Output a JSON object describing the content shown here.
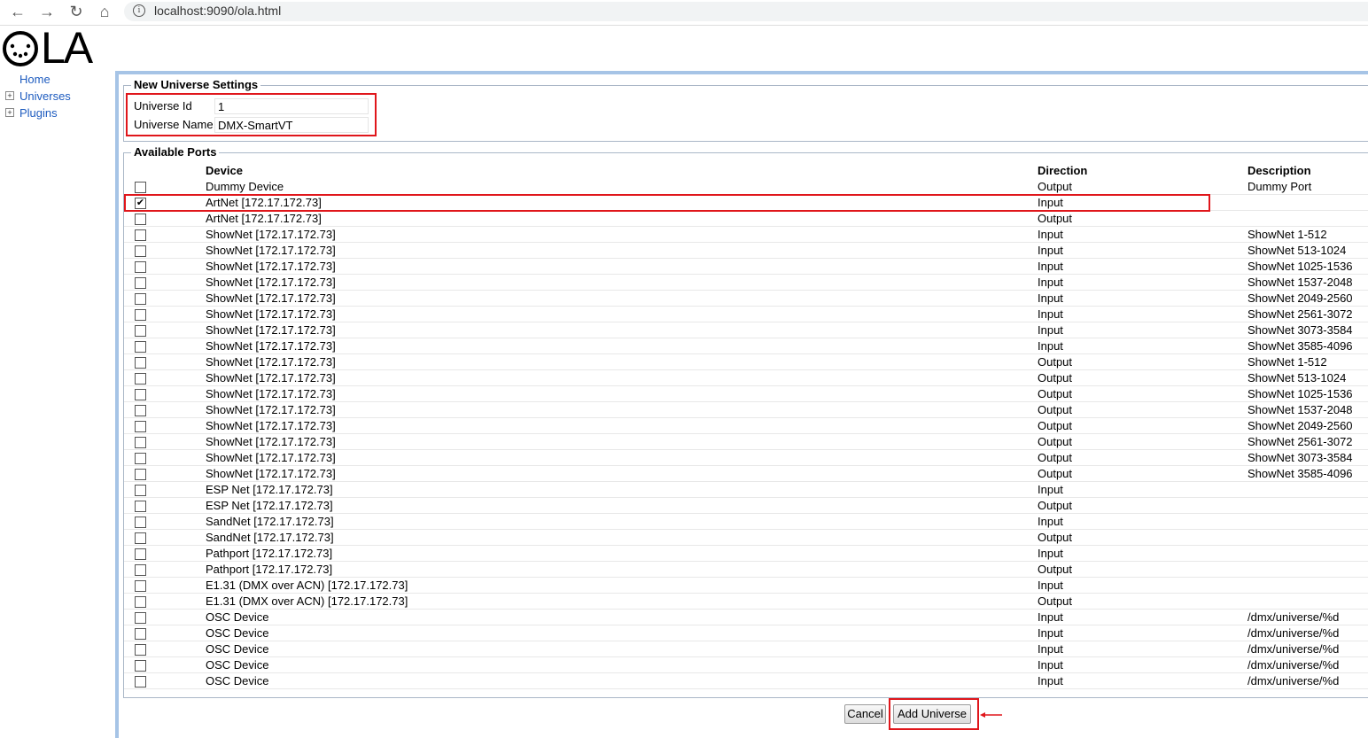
{
  "browser": {
    "url": "localhost:9090/ola.html"
  },
  "logo": {
    "text": "LA"
  },
  "sidebar": {
    "items": [
      {
        "label": "Home",
        "expandable": false
      },
      {
        "label": "Universes",
        "expandable": true
      },
      {
        "label": "Plugins",
        "expandable": true
      }
    ]
  },
  "settings": {
    "legend": "New Universe Settings",
    "universe_id_label": "Universe Id",
    "universe_id_value": "1",
    "universe_name_label": "Universe Name",
    "universe_name_value": "DMX-SmartVT"
  },
  "ports": {
    "legend": "Available Ports",
    "headers": {
      "device": "Device",
      "direction": "Direction",
      "description": "Description"
    },
    "rows": [
      {
        "device": "Dummy Device",
        "direction": "Output",
        "description": "Dummy Port",
        "checked": false
      },
      {
        "device": "ArtNet [172.17.172.73]",
        "direction": "Input",
        "description": "",
        "checked": true
      },
      {
        "device": "ArtNet [172.17.172.73]",
        "direction": "Output",
        "description": "",
        "checked": false
      },
      {
        "device": "ShowNet [172.17.172.73]",
        "direction": "Input",
        "description": "ShowNet 1-512",
        "checked": false
      },
      {
        "device": "ShowNet [172.17.172.73]",
        "direction": "Input",
        "description": "ShowNet 513-1024",
        "checked": false
      },
      {
        "device": "ShowNet [172.17.172.73]",
        "direction": "Input",
        "description": "ShowNet 1025-1536",
        "checked": false
      },
      {
        "device": "ShowNet [172.17.172.73]",
        "direction": "Input",
        "description": "ShowNet 1537-2048",
        "checked": false
      },
      {
        "device": "ShowNet [172.17.172.73]",
        "direction": "Input",
        "description": "ShowNet 2049-2560",
        "checked": false
      },
      {
        "device": "ShowNet [172.17.172.73]",
        "direction": "Input",
        "description": "ShowNet 2561-3072",
        "checked": false
      },
      {
        "device": "ShowNet [172.17.172.73]",
        "direction": "Input",
        "description": "ShowNet 3073-3584",
        "checked": false
      },
      {
        "device": "ShowNet [172.17.172.73]",
        "direction": "Input",
        "description": "ShowNet 3585-4096",
        "checked": false
      },
      {
        "device": "ShowNet [172.17.172.73]",
        "direction": "Output",
        "description": "ShowNet 1-512",
        "checked": false
      },
      {
        "device": "ShowNet [172.17.172.73]",
        "direction": "Output",
        "description": "ShowNet 513-1024",
        "checked": false
      },
      {
        "device": "ShowNet [172.17.172.73]",
        "direction": "Output",
        "description": "ShowNet 1025-1536",
        "checked": false
      },
      {
        "device": "ShowNet [172.17.172.73]",
        "direction": "Output",
        "description": "ShowNet 1537-2048",
        "checked": false
      },
      {
        "device": "ShowNet [172.17.172.73]",
        "direction": "Output",
        "description": "ShowNet 2049-2560",
        "checked": false
      },
      {
        "device": "ShowNet [172.17.172.73]",
        "direction": "Output",
        "description": "ShowNet 2561-3072",
        "checked": false
      },
      {
        "device": "ShowNet [172.17.172.73]",
        "direction": "Output",
        "description": "ShowNet 3073-3584",
        "checked": false
      },
      {
        "device": "ShowNet [172.17.172.73]",
        "direction": "Output",
        "description": "ShowNet 3585-4096",
        "checked": false
      },
      {
        "device": "ESP Net [172.17.172.73]",
        "direction": "Input",
        "description": "",
        "checked": false
      },
      {
        "device": "ESP Net [172.17.172.73]",
        "direction": "Output",
        "description": "",
        "checked": false
      },
      {
        "device": "SandNet [172.17.172.73]",
        "direction": "Input",
        "description": "",
        "checked": false
      },
      {
        "device": "SandNet [172.17.172.73]",
        "direction": "Output",
        "description": "",
        "checked": false
      },
      {
        "device": "Pathport [172.17.172.73]",
        "direction": "Input",
        "description": "",
        "checked": false
      },
      {
        "device": "Pathport [172.17.172.73]",
        "direction": "Output",
        "description": "",
        "checked": false
      },
      {
        "device": "E1.31 (DMX over ACN) [172.17.172.73]",
        "direction": "Input",
        "description": "",
        "checked": false
      },
      {
        "device": "E1.31 (DMX over ACN) [172.17.172.73]",
        "direction": "Output",
        "description": "",
        "checked": false
      },
      {
        "device": "OSC Device",
        "direction": "Input",
        "description": "/dmx/universe/%d",
        "checked": false
      },
      {
        "device": "OSC Device",
        "direction": "Input",
        "description": "/dmx/universe/%d",
        "checked": false
      },
      {
        "device": "OSC Device",
        "direction": "Input",
        "description": "/dmx/universe/%d",
        "checked": false
      },
      {
        "device": "OSC Device",
        "direction": "Input",
        "description": "/dmx/universe/%d",
        "checked": false
      },
      {
        "device": "OSC Device",
        "direction": "Input",
        "description": "/dmx/universe/%d",
        "checked": false
      }
    ]
  },
  "buttons": {
    "cancel_label": "Cancel",
    "add_universe_label": "Add Universe"
  },
  "colors": {
    "highlight": "#e0161b",
    "panel_border": "#a6c4e6",
    "link": "#1d5bbf"
  }
}
